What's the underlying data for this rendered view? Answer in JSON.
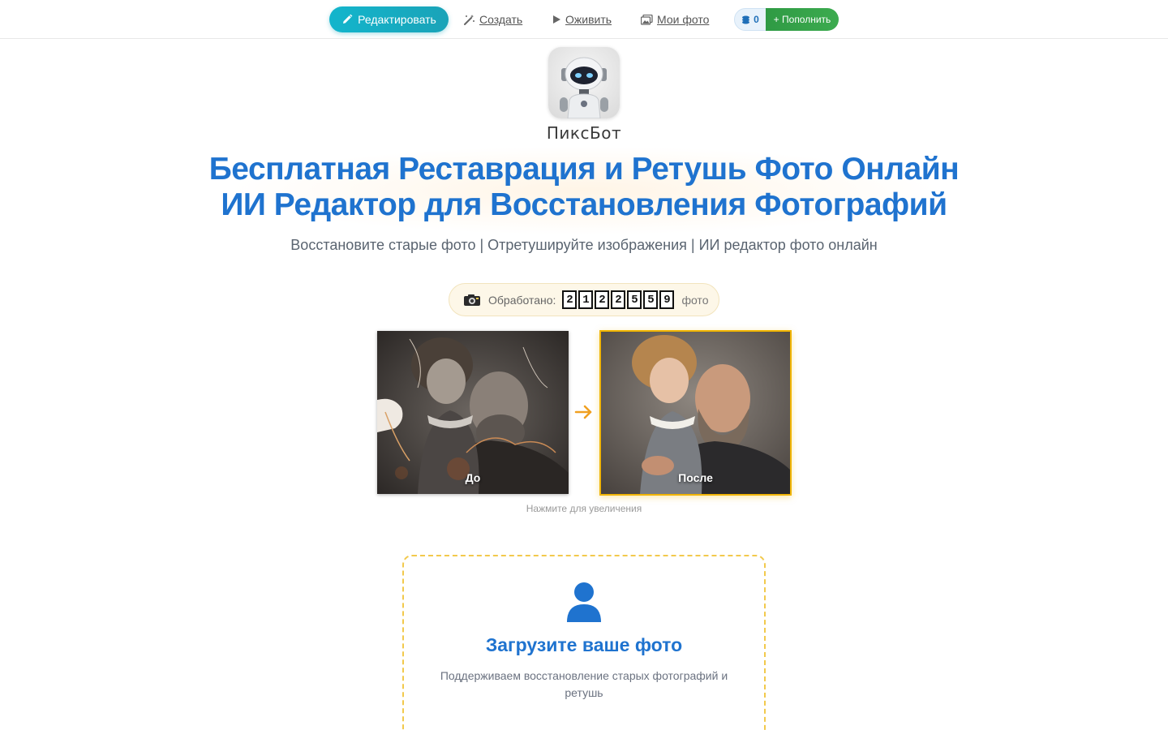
{
  "nav": {
    "edit_label": "Редактировать",
    "create_label": "Создать",
    "animate_label": "Оживить",
    "my_photos_label": "Мои фото",
    "balance_value": "0",
    "topup_label": "+ Пополнить"
  },
  "brand": {
    "name": "ПиксБот"
  },
  "hero": {
    "title_line1": "Бесплатная Реставрация и Ретушь Фото Онлайн",
    "title_line2": "ИИ Редактор для Восстановления Фотографий",
    "subtitle": "Восстановите старые фото | Отретушируйте изображения | ИИ редактор фото онлайн"
  },
  "counter": {
    "label": "Обработано:",
    "digits": [
      "2",
      "1",
      "2",
      "2",
      "5",
      "5",
      "9"
    ],
    "unit": "фото"
  },
  "comparison": {
    "before_label": "До",
    "after_label": "После",
    "hint": "Нажмите для увеличения"
  },
  "upload": {
    "title": "Загрузите ваше фото",
    "description": "Поддерживаем восстановление старых фотографий и ретушь"
  },
  "colors": {
    "accent_blue": "#1f73cf",
    "edit_button": "#13b5cc",
    "topup_button": "#2f9a44",
    "after_border": "#f0b400",
    "upload_border": "#f2c94c"
  }
}
